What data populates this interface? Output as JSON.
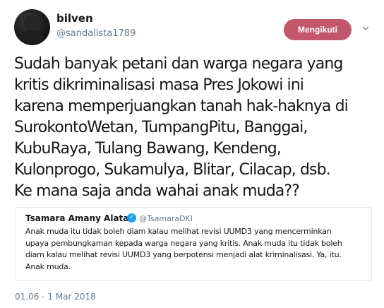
{
  "author": {
    "name": "bilven",
    "handle": "@sandalista1789"
  },
  "follow_button": {
    "label": "Mengikuti"
  },
  "menu": {
    "icon": "chevron-down-icon"
  },
  "tweet": {
    "lines": [
      "Sudah banyak petani dan warga negara yang",
      "kritis dikriminalisasi masa Pres Jokowi ini",
      "karena memperjuangkan tanah hak-haknya di",
      "SurokontoWetan, TumpangPitu, Banggai,",
      "KubuRaya, Tulang Bawang, Kendeng,",
      "Kulonprogo, Sukamulya, Blitar, Cilacap, dsb.",
      "Ke mana saja anda wahai anak muda??"
    ],
    "timestamp": "01.06 - 1 Mar 2018"
  },
  "quoted_tweet": {
    "name": "Tsamara Amany Alatas",
    "verified_icon": "verified-badge-icon",
    "handle": "@TsamaraDKI",
    "lines": [
      "Anak muda itu tidak boleh diam kalau melihat revisi UUMD3 yang mencerminkan",
      "upaya pembungkaman kepada warga negara yang kritis.  Anak muda itu tidak boleh",
      "diam kalau melihat revisi UUMD3 yang berpotensi menjadi alat kriminalisasi. Ya, itu.",
      "Anak muda."
    ]
  },
  "colors": {
    "follow_button_bg": "#c2566b",
    "verified_badge": "#1da1f2",
    "secondary_text": "#657786"
  }
}
